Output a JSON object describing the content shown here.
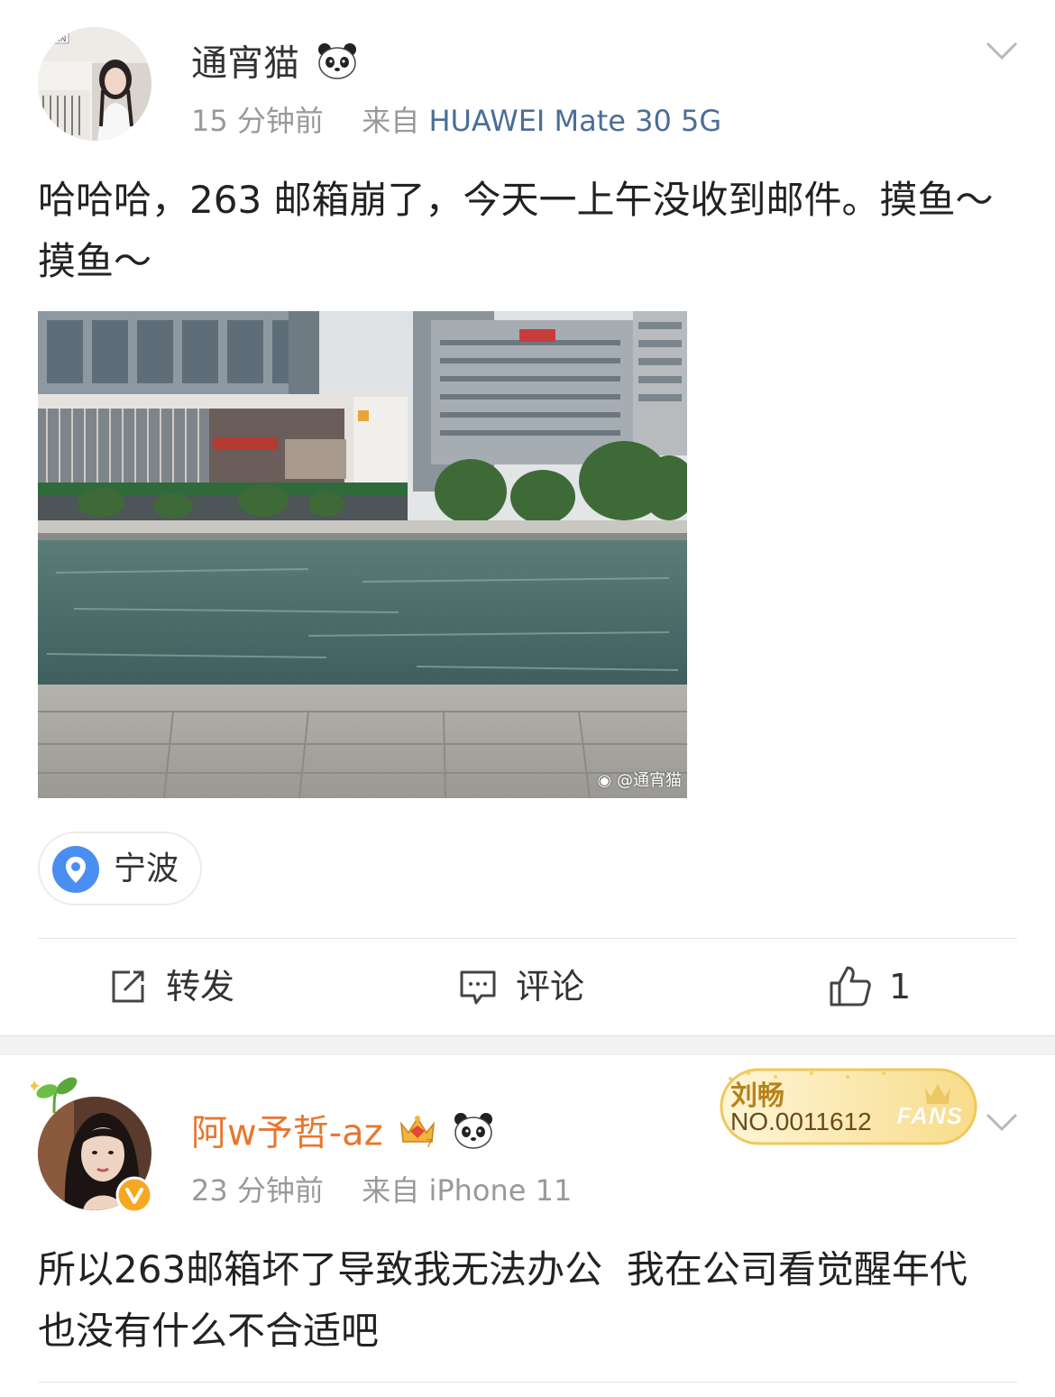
{
  "post1": {
    "user": {
      "name": "通宵猫",
      "emoji_badge": "panda-emoji"
    },
    "time": "15 分钟前",
    "source_prefix": "来自",
    "source": "HUAWEI Mate 30 5G",
    "text": "哈哈哈，263 邮箱崩了，今天一上午没收到邮件。摸鱼～摸鱼～",
    "photo": {
      "watermark": "@通宵猫"
    },
    "location": {
      "icon": "location-pin-icon",
      "label": "宁波"
    },
    "actions": {
      "repost": {
        "icon": "repost-icon",
        "label": "转发"
      },
      "comment": {
        "icon": "comment-icon",
        "label": "评论"
      },
      "like": {
        "icon": "thumbs-up-icon",
        "count": "1"
      }
    }
  },
  "post2": {
    "user": {
      "name": "阿w予哲-az",
      "badges": [
        "crown-vip-icon",
        "panda-emoji"
      ],
      "verified": true
    },
    "fan_badge": {
      "name": "刘畅",
      "number": "NO.0011612",
      "fans": "FANS"
    },
    "time": "23 分钟前",
    "source_prefix": "来自",
    "source": "iPhone 11",
    "text": "所以263邮箱坏了导致我无法办公  我在公司看觉醒年代  也没有什么不合适吧"
  },
  "colors": {
    "source_link": "#4b6e98",
    "vip_name": "#e8772e",
    "location_blue": "#4a8ef2",
    "badge_gold": "#f4d37a"
  }
}
